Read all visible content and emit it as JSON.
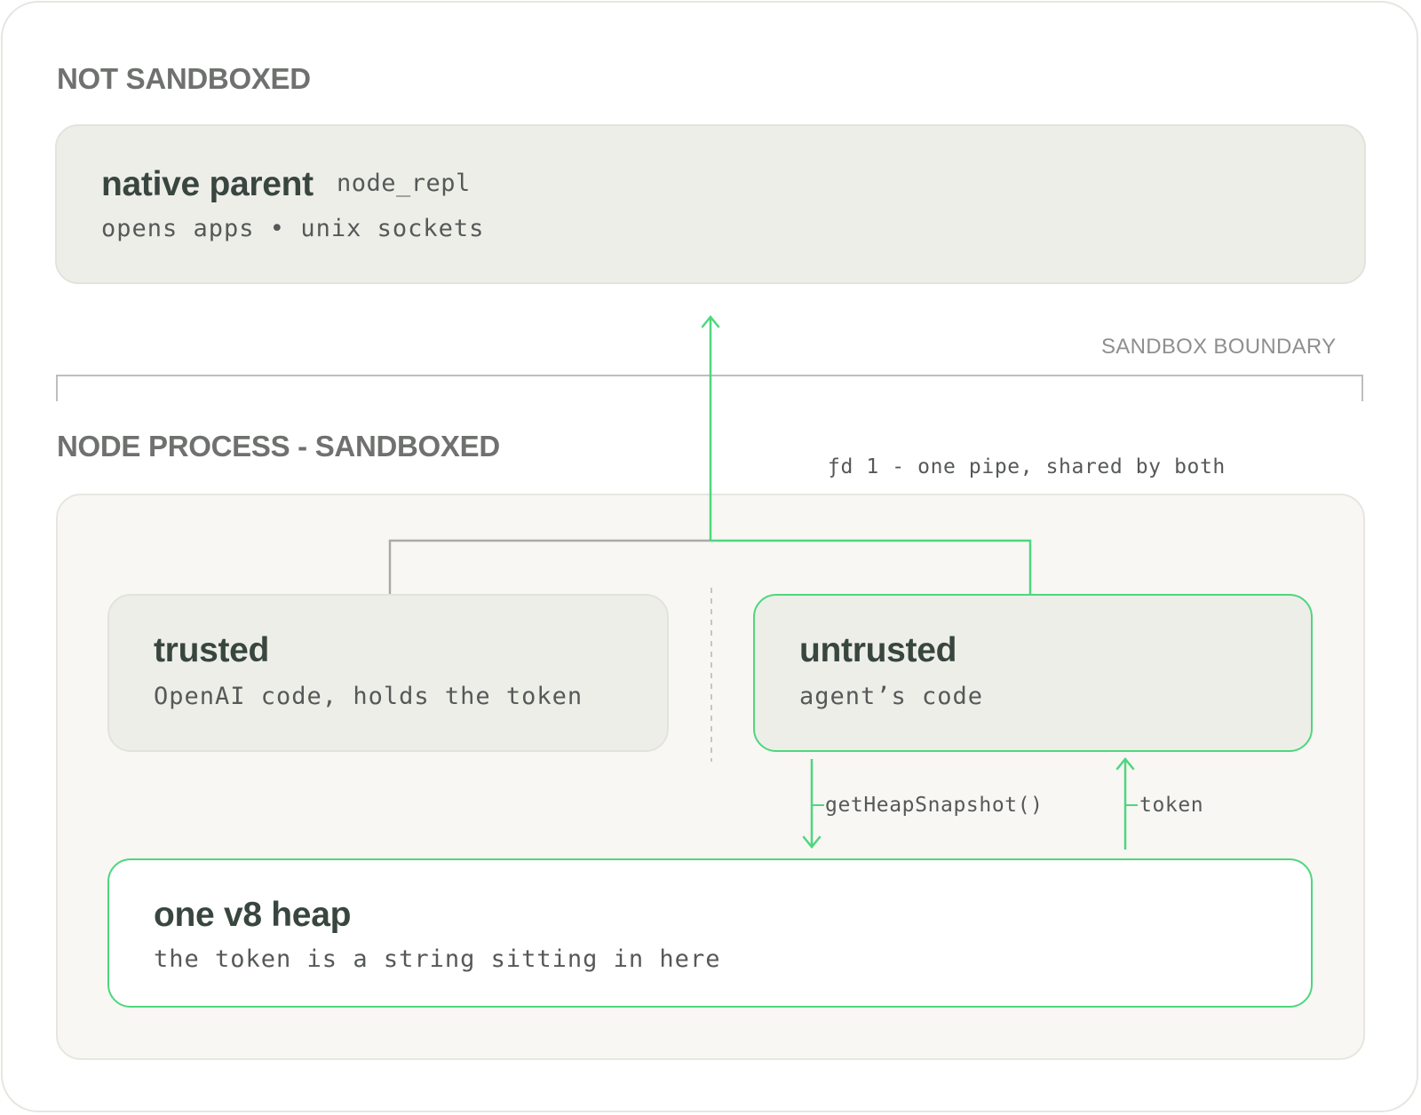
{
  "sections": {
    "not_sandboxed": "NOT SANDBOXED",
    "sandboxed": "NODE PROCESS - SANDBOXED",
    "boundary": "SANDBOX BOUNDARY"
  },
  "native_parent": {
    "title": "native parent",
    "tag": "node_repl",
    "description": "opens apps • unix sockets"
  },
  "pipe_label": "ƒd 1 - one pipe, shared by both",
  "trusted": {
    "title": "trusted",
    "description": "OpenAI code, holds the token"
  },
  "untrusted": {
    "title": "untrusted",
    "description": "agent’s code"
  },
  "heap": {
    "title": "one v8 heap",
    "description": "the token is a string sitting in here"
  },
  "arrows": {
    "down_label": "getHeapSnapshot()",
    "up_label": "token"
  },
  "colors": {
    "accent_green": "#4fd67e",
    "neutral_line": "#a9aba7",
    "heading_gray": "#6e716e",
    "title_dark": "#38463f"
  }
}
